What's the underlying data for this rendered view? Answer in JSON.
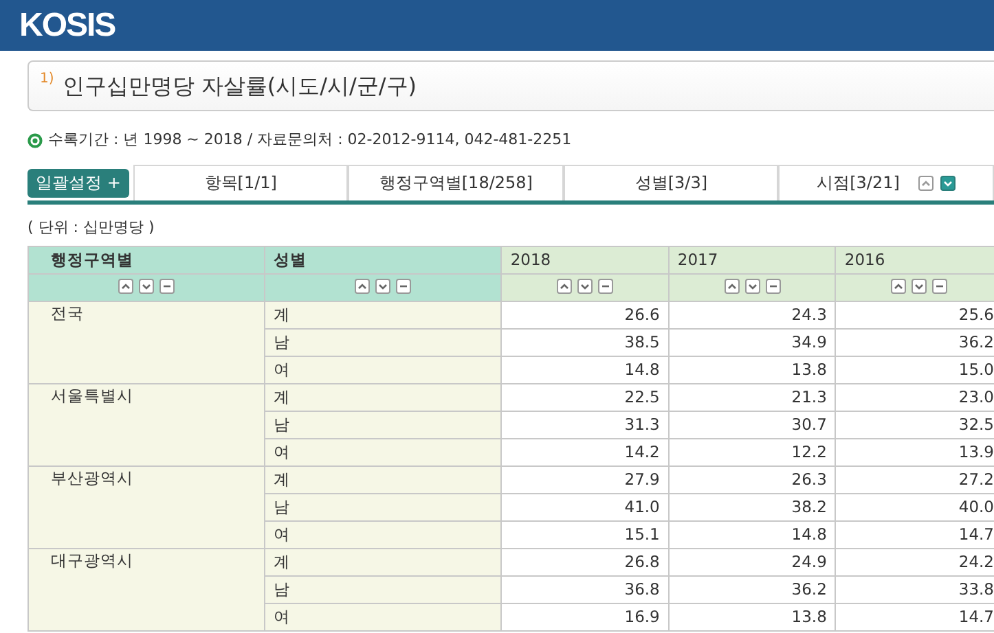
{
  "logo": "KOSIS",
  "title": {
    "note": "1)",
    "text": "인구십만명당 자살률(시도/시/군/구)"
  },
  "info": "수록기간 : 년 1998 ~ 2018 / 자료문의처 : 02-2012-9114, 042-481-2251",
  "bulk_button": "일괄설정 +",
  "tabs": [
    {
      "label": "항목[1/1]"
    },
    {
      "label": "행정구역별[18/258]"
    },
    {
      "label": "성별[3/3]"
    },
    {
      "label": "시점[3/21]"
    }
  ],
  "unit": "( 단위 : 십만명당 )",
  "table": {
    "columns": [
      "행정구역별",
      "성별",
      "2018",
      "2017",
      "2016"
    ],
    "rows": [
      {
        "region": "전국",
        "items": [
          {
            "sex": "계",
            "values": [
              "26.6",
              "24.3",
              "25.6"
            ]
          },
          {
            "sex": "남",
            "values": [
              "38.5",
              "34.9",
              "36.2"
            ]
          },
          {
            "sex": "여",
            "values": [
              "14.8",
              "13.8",
              "15.0"
            ]
          }
        ]
      },
      {
        "region": "서울특별시",
        "items": [
          {
            "sex": "계",
            "values": [
              "22.5",
              "21.3",
              "23.0"
            ]
          },
          {
            "sex": "남",
            "values": [
              "31.3",
              "30.7",
              "32.5"
            ]
          },
          {
            "sex": "여",
            "values": [
              "14.2",
              "12.2",
              "13.9"
            ]
          }
        ]
      },
      {
        "region": "부산광역시",
        "items": [
          {
            "sex": "계",
            "values": [
              "27.9",
              "26.3",
              "27.2"
            ]
          },
          {
            "sex": "남",
            "values": [
              "41.0",
              "38.2",
              "40.0"
            ]
          },
          {
            "sex": "여",
            "values": [
              "15.1",
              "14.8",
              "14.7"
            ]
          }
        ]
      },
      {
        "region": "대구광역시",
        "items": [
          {
            "sex": "계",
            "values": [
              "26.8",
              "24.9",
              "24.2"
            ]
          },
          {
            "sex": "남",
            "values": [
              "36.8",
              "36.2",
              "33.8"
            ]
          },
          {
            "sex": "여",
            "values": [
              "16.9",
              "13.8",
              "14.7"
            ]
          }
        ]
      }
    ]
  }
}
